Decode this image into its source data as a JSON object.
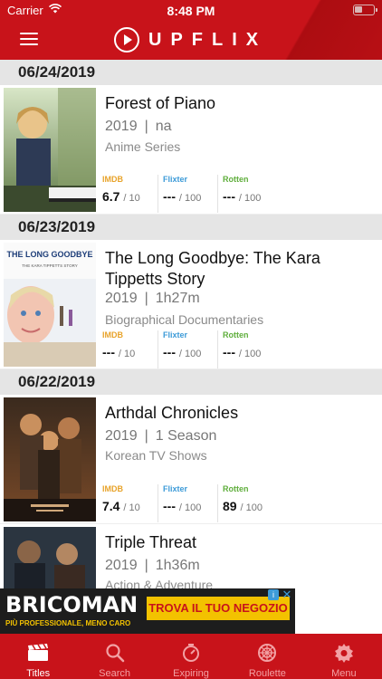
{
  "status_bar": {
    "carrier": "Carrier",
    "time": "8:48 PM"
  },
  "app": {
    "logo_text": "UPFLIX",
    "accent_color": "#c8131a"
  },
  "sections": [
    {
      "date": "06/24/2019",
      "items": [
        {
          "title": "Forest of Piano",
          "year": "2019",
          "duration": "na",
          "genre": "Anime Series",
          "ratings": {
            "imdb_label": "IMDB",
            "imdb_value": "6.7",
            "imdb_den": "/ 10",
            "flixter_label": "Flixter",
            "flixter_value": "---",
            "flixter_den": "/ 100",
            "rotten_label": "Rotten",
            "rotten_value": "---",
            "rotten_den": "/ 100"
          }
        }
      ]
    },
    {
      "date": "06/23/2019",
      "items": [
        {
          "title": "The Long Goodbye: The Kara Tippetts Story",
          "year": "2019",
          "duration": "1h27m",
          "genre": "Biographical Documentaries",
          "poster_title": "THE LONG GOODBYE",
          "poster_subtitle": "THE KARA TIPPETTS STORY",
          "ratings": {
            "imdb_label": "IMDB",
            "imdb_value": "---",
            "imdb_den": "/ 10",
            "flixter_label": "Flixter",
            "flixter_value": "---",
            "flixter_den": "/ 100",
            "rotten_label": "Rotten",
            "rotten_value": "---",
            "rotten_den": "/ 100"
          }
        }
      ]
    },
    {
      "date": "06/22/2019",
      "items": [
        {
          "title": "Arthdal Chronicles",
          "year": "2019",
          "duration": "1 Season",
          "genre": "Korean TV Shows",
          "ratings": {
            "imdb_label": "IMDB",
            "imdb_value": "7.4",
            "imdb_den": "/ 10",
            "flixter_label": "Flixter",
            "flixter_value": "---",
            "flixter_den": "/ 100",
            "rotten_label": "Rotten",
            "rotten_value": "89",
            "rotten_den": "/ 100"
          }
        },
        {
          "title": "Triple Threat",
          "year": "2019",
          "duration": "1h36m",
          "genre": "Action & Adventure"
        }
      ]
    }
  ],
  "ad": {
    "brand": "BRICOMAN",
    "tagline": "PIÙ PROFESSIONALE, MENO CARO",
    "cta": "TROVA IL TUO NEGOZIO",
    "info_glyph": "i",
    "close_glyph": "✕"
  },
  "tabs": [
    {
      "label": "Titles",
      "icon": "clapperboard-icon",
      "active": true
    },
    {
      "label": "Search",
      "icon": "search-icon"
    },
    {
      "label": "Expiring",
      "icon": "timer-icon"
    },
    {
      "label": "Roulette",
      "icon": "roulette-wheel-icon"
    },
    {
      "label": "Menu",
      "icon": "gear-icon"
    }
  ]
}
